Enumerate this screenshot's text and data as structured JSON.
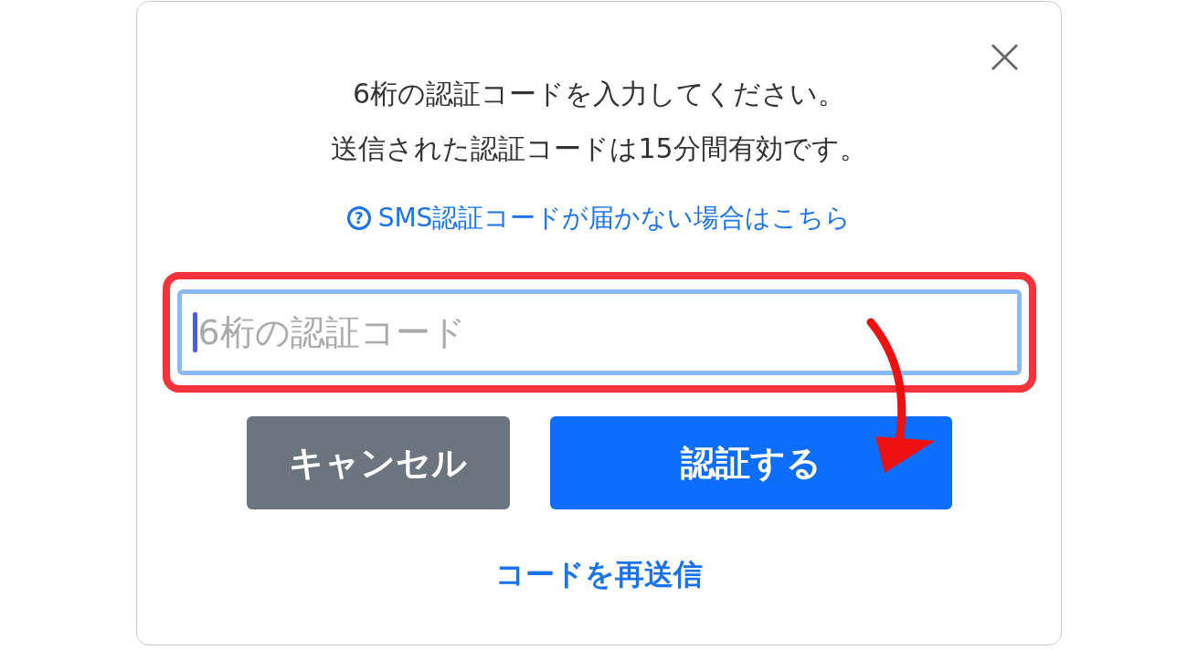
{
  "dialog": {
    "close": "×",
    "message_lines": [
      "6桁の認証コードを入力してください。",
      "送信された認証コードは15分間有効です。"
    ],
    "help_link": {
      "icon": "?",
      "label": "SMS認証コードが届かない場合はこちら"
    },
    "code_field": {
      "placeholder": "6桁の認証コード",
      "focused": true
    },
    "buttons": [
      {
        "label": "キャンセル",
        "kind": "secondary"
      },
      {
        "label": "認証する",
        "kind": "primary"
      }
    ],
    "resend_link": "コードを再送信"
  }
}
